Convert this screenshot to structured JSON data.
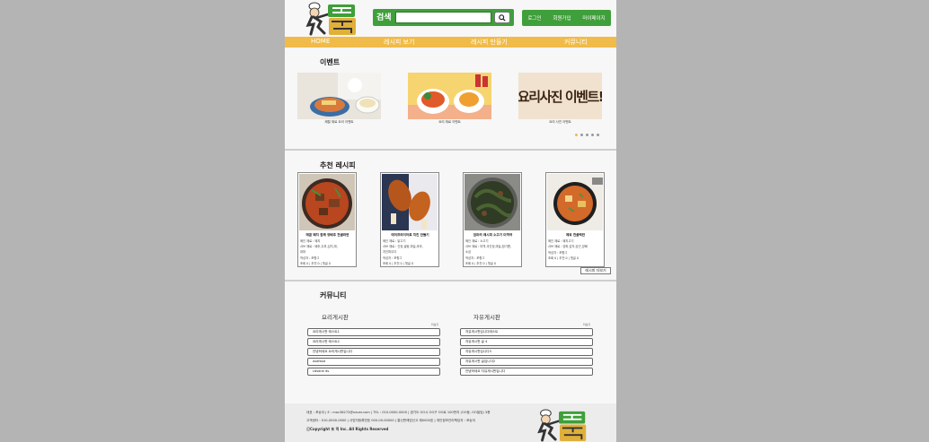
{
  "header": {
    "search_label": "검색",
    "search_value": "",
    "user_menu": [
      "로그인",
      "회원가입",
      "마이페이지"
    ]
  },
  "nav": {
    "items": [
      "HOME",
      "레시피 보기",
      "레시피 만들기",
      "커뮤니티"
    ]
  },
  "events": {
    "title": "이벤트",
    "items": [
      {
        "caption": "제철 재료 요리 이벤트"
      },
      {
        "caption": "요리 재료 이벤트"
      },
      {
        "caption": "요리 사진 이벤트",
        "banner_text": "요리사진 이벤트!"
      }
    ],
    "page_count": 5,
    "active_page": 1
  },
  "recipes": {
    "title": "추천 레시피",
    "more_label": "레시피 더보기",
    "items": [
      {
        "title": "매콤 돼지 함께 양배추 전골라면",
        "lines": [
          "메인 재료 : 돼지",
          "서브 재료 : 배추,두부,김치,파,",
          "대파",
          "작성자 : 포항그",
          "조회 0 | 추천 0 | 댓글 0"
        ]
      },
      {
        "title": "에어프라이어로 치킨 만들기",
        "lines": [
          "메인 재료 : 닭고기",
          "서브 재료 : 간장,설탕,마늘,후추,",
          "치킨파우더",
          "작성자 : 포항그",
          "조회 0 | 추천 0 | 댓글 0"
        ]
      },
      {
        "title": "엄마의 레시피 소고기 미역국",
        "lines": [
          "메인 재료 : 소고기",
          "서브 재료 : 미역,국간장,마늘,참기름,",
          "소금",
          "작성자 : 포항그",
          "조회 0 | 추천 0 | 댓글 0"
        ]
      },
      {
        "title": "제육 전골백반",
        "lines": [
          "메인 재료 : 돼지고기",
          "서브 재료 : 양파,감자,당근,양배",
          "작성자 : 포항그",
          "조회 0 | 추천 0 | 댓글 0"
        ]
      }
    ]
  },
  "community": {
    "title": "커뮤니티",
    "more_label": "더보기",
    "boards": [
      {
        "title": "요리게시판",
        "posts": [
          "요리게시판 테스트1",
          "요리게시판 테스트2",
          "안녕하세요 요리게시판입니다",
          "asdfasd",
          "cdsdrw ds"
        ]
      },
      {
        "title": "자유게시판",
        "posts": [
          "자유게시판입니다테스트",
          "자유게시판 글 4",
          "자유게시판입니다3",
          "자유게시판 글입니다2",
          "안녕하세요 자유게시판입니다"
        ]
      }
    ]
  },
  "footer": {
    "line1": "대표 : 포송이 | E : moc36272@naver.com | TEL : 010-0000-0000 | 경기도 OO시 OO구 OO로 100번지 (OO동, OO빌딩) 3층",
    "line2": "고객센터 : 010-0000-0000 | 사업자등록번호 000-00-00000 | 통신판매업신고 제0000호 | 개인정보관리책임자 : 포송이",
    "copyright": "ⓒCopyright 또 먹 Inc. All Rights Reserved"
  },
  "colors": {
    "brand_green": "#3f9f3a",
    "nav_yellow": "#f0bb48",
    "page_bg": "#f7f7f7",
    "outer_bg": "#b4b4b4"
  },
  "icons": [
    "chef-logo-icon",
    "search-icon"
  ]
}
